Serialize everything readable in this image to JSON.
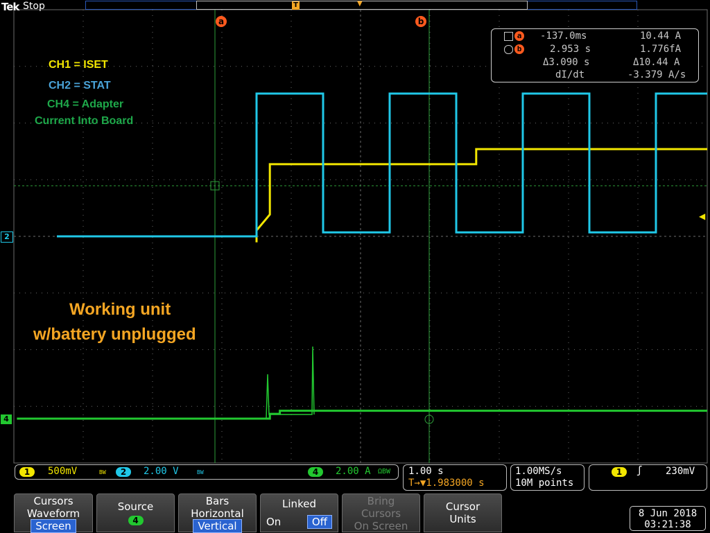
{
  "header": {
    "brand": "Tek",
    "acquisition_state": "Stop",
    "trigger_marker": "T"
  },
  "cursors": {
    "a_marker": "a",
    "b_marker": "b"
  },
  "readout": {
    "row1": {
      "marker": "a",
      "time": "-137.0ms",
      "value": "10.44 A"
    },
    "row2": {
      "marker": "b",
      "time": "2.953 s",
      "value": "1.776fA"
    },
    "row3": {
      "delta_time": "Δ3.090 s",
      "delta_value": "Δ10.44 A"
    },
    "row4": {
      "label": "dI/dt",
      "value": "-3.379 A/s"
    }
  },
  "annotations": {
    "ch1": "CH1 = ISET",
    "ch2": "CH2 = STAT",
    "ch4_line1": "CH4 = Adapter",
    "ch4_line2": "Current Into Board",
    "note_line1": "Working unit",
    "note_line2": "w/battery unplugged"
  },
  "channel_markers": {
    "ch2": "2",
    "ch4": "4"
  },
  "scale_bar": {
    "ch1_num": "1",
    "ch1_scale": "500mV",
    "ch1_bw": "BW",
    "ch2_num": "2",
    "ch2_scale": "2.00 V",
    "ch2_bw": "BW",
    "ch4_num": "4",
    "ch4_scale": "2.00 A",
    "ch4_term": "ΩBW",
    "timebase": "1.00 s",
    "trigger_pos": "T→▼1.983000 s",
    "sample_rate": "1.00MS/s",
    "record_length": "10M points",
    "trig_ch": "1",
    "trig_slope": "ʃ",
    "trig_level": "230mV"
  },
  "menu": {
    "cursors": {
      "line1": "Cursors",
      "line2": "Waveform",
      "line3": "Screen"
    },
    "source": {
      "line1": "Source",
      "value": "4"
    },
    "bars": {
      "line1": "Bars",
      "line2": "Horizontal",
      "line3": "Vertical"
    },
    "linked": {
      "line1": "Linked",
      "on": "On",
      "off": "Off"
    },
    "bring": {
      "line1": "Bring",
      "line2": "Cursors",
      "line3": "On Screen"
    },
    "units": {
      "line1": "Cursor",
      "line2": "Units"
    }
  },
  "datetime": {
    "date": "8 Jun 2018",
    "time": "03:21:38"
  },
  "colors": {
    "ch1": "#f2e600",
    "ch2": "#20c8e8",
    "ch4": "#22c830",
    "cursor_marker": "#ff5a1e",
    "annotation_orange": "#f5a623",
    "grid": "#6c6c6c"
  },
  "chart_data": {
    "type": "line",
    "x_divisions": 10,
    "y_divisions": 8,
    "x_units": "s",
    "x_per_div": 1.0,
    "cursor_a_time": -0.137,
    "cursor_b_time": 2.953,
    "series": [
      {
        "name": "CH1 = ISET",
        "color": "#f2e600",
        "points_div": [
          [
            0.0,
            -0.15
          ],
          [
            0.0,
            0.15
          ],
          [
            0.2,
            0.55
          ],
          [
            0.2,
            1.82
          ],
          [
            3.3,
            1.82
          ],
          [
            3.3,
            2.2
          ],
          [
            10,
            2.2
          ]
        ]
      },
      {
        "name": "CH2 = STAT",
        "color": "#20c8e8",
        "points_div": [
          [
            -3.0,
            0.0
          ],
          [
            0.0,
            0.0
          ],
          [
            0.0,
            3.6
          ],
          [
            1.0,
            3.6
          ],
          [
            1.0,
            0.1
          ],
          [
            2.0,
            0.1
          ],
          [
            2.0,
            3.6
          ],
          [
            3.0,
            3.6
          ],
          [
            3.0,
            0.1
          ],
          [
            4.0,
            0.1
          ],
          [
            4.0,
            3.6
          ],
          [
            5.0,
            3.6
          ],
          [
            5.0,
            0.1
          ],
          [
            6.0,
            0.1
          ],
          [
            6.0,
            3.6
          ],
          [
            7.0,
            3.6
          ]
        ]
      },
      {
        "name": "CH4 = Adapter",
        "color": "#22c830",
        "points_div": [
          [
            -3.6,
            0.0
          ],
          [
            0.2,
            0.0
          ],
          [
            0.2,
            0.12
          ],
          [
            0.35,
            0.12
          ],
          [
            0.35,
            0.2
          ],
          [
            10,
            0.2
          ]
        ]
      }
    ]
  }
}
